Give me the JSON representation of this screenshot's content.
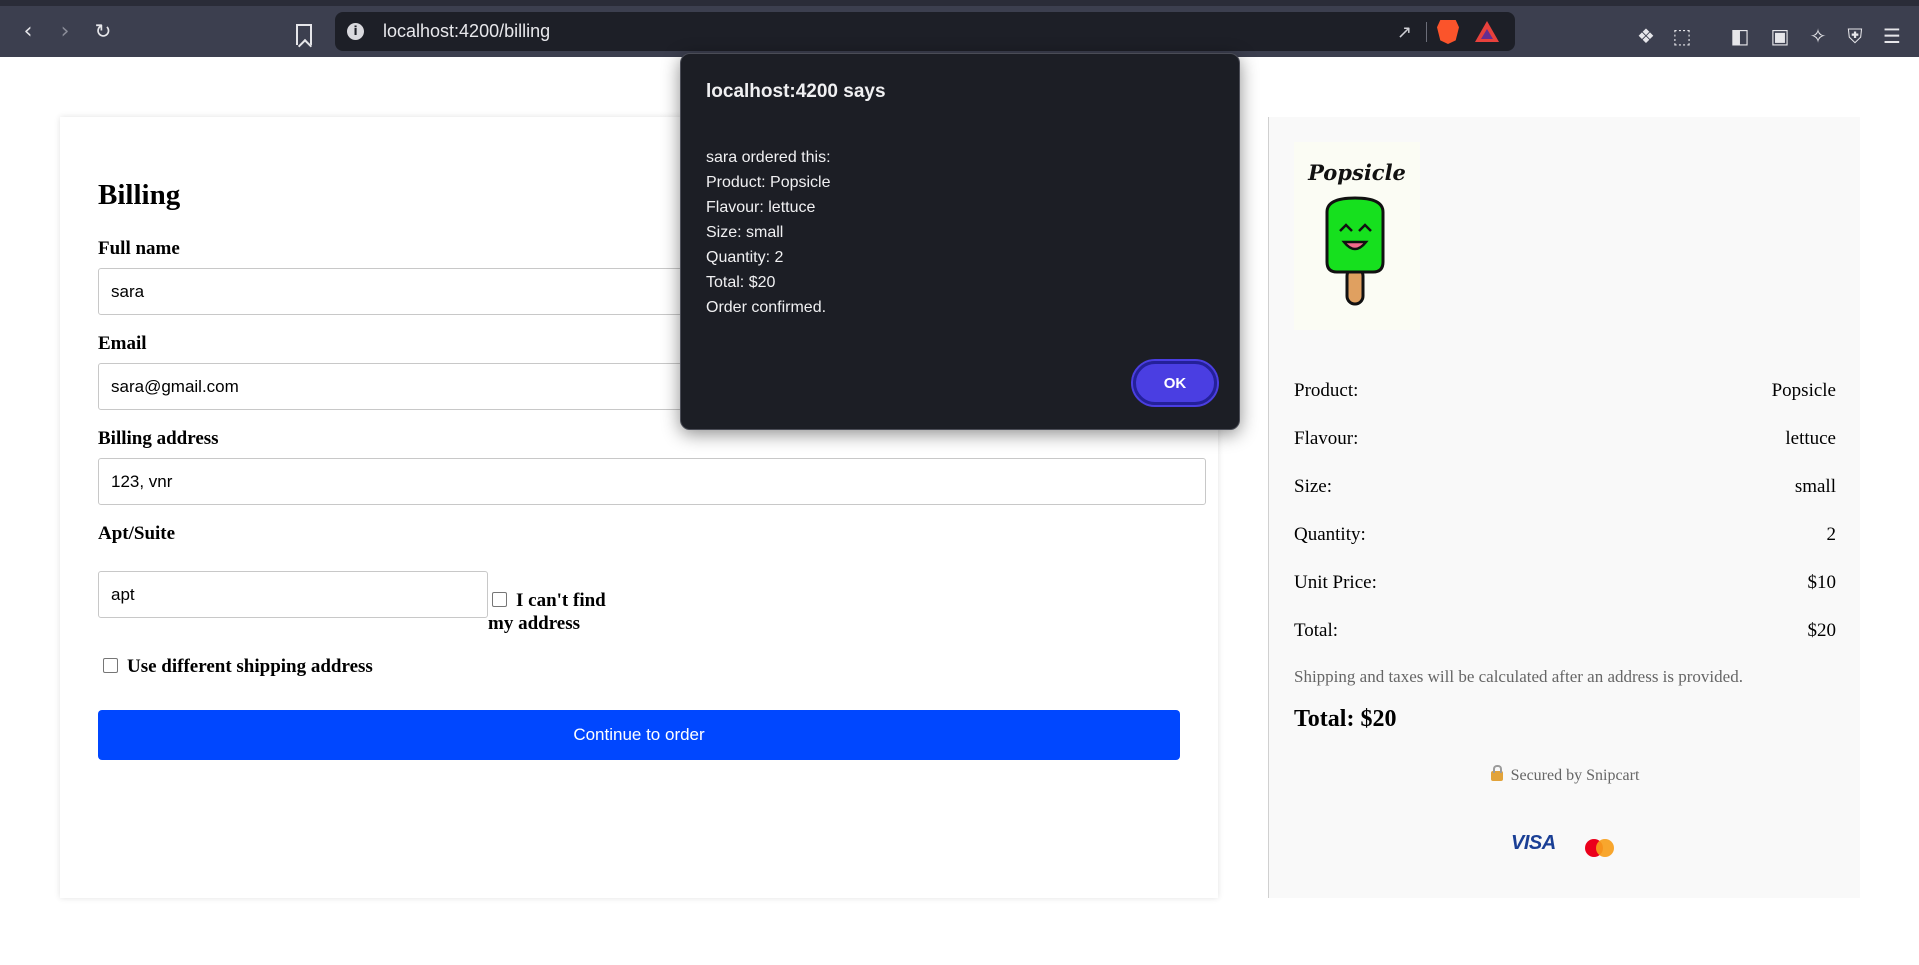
{
  "browser": {
    "url": "localhost:4200/billing",
    "icons": [
      "back-icon",
      "forward-icon",
      "reload-icon",
      "bookmark-icon",
      "site-info-icon",
      "share-icon",
      "brave-shields-icon",
      "brave-rewards-icon",
      "extensions-icon",
      "screenshot-icon",
      "sidebar-icon",
      "wallet-icon",
      "leo-ai-icon",
      "vpn-icon",
      "menu-icon"
    ]
  },
  "billing": {
    "title": "Billing",
    "full_name": {
      "label": "Full name",
      "value": "sara"
    },
    "email": {
      "label": "Email",
      "value": "sara@gmail.com"
    },
    "address": {
      "label": "Billing address",
      "value": "123, vnr"
    },
    "apt": {
      "label": "Apt/Suite",
      "value": "apt"
    },
    "cant_find_label_1": "I can't find",
    "cant_find_label_2": "my address",
    "shipping_label": "Use different shipping address",
    "continue_label": "Continue to order",
    "accent_color": "#0047ff"
  },
  "summary": {
    "product_logo_text": "Popsicle",
    "rows": [
      {
        "label": "Product:",
        "value": "Popsicle"
      },
      {
        "label": "Flavour:",
        "value": "lettuce"
      },
      {
        "label": "Size:",
        "value": "small"
      },
      {
        "label": "Quantity:",
        "value": "2"
      },
      {
        "label": "Unit Price:",
        "value": "$10"
      },
      {
        "label": "Total:",
        "value": "$20"
      }
    ],
    "note": "Shipping and taxes will be calculated after an address is provided.",
    "total_big": "Total: $20",
    "secured": "Secured by Snipcart",
    "visa": "VISA"
  },
  "dialog": {
    "title": "localhost:4200 says",
    "lines": [
      "sara ordered this:",
      "Product: Popsicle",
      "Flavour: lettuce",
      "Size: small",
      "Quantity: 2",
      "Total: $20",
      "Order confirmed."
    ],
    "ok_label": "OK",
    "ok_color": "#4a3ee2"
  }
}
